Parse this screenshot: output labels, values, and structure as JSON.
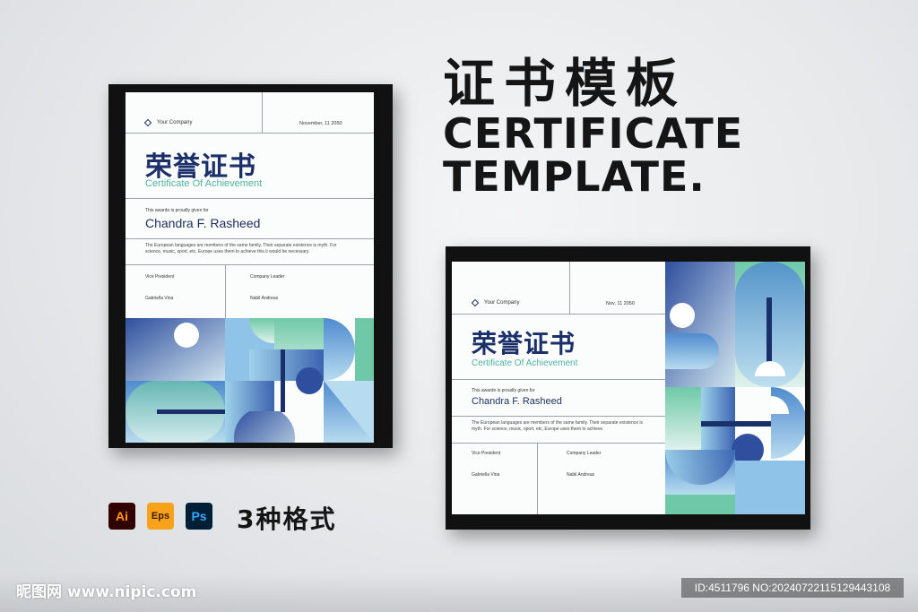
{
  "headline": {
    "cn": "证书模板",
    "en_line1": "CERTIFICATE",
    "en_line2": "TEMPLATE."
  },
  "certificate": {
    "company": "Your Company",
    "title_cn": "荣誉证书",
    "subtitle": "Certificate Of Achievement",
    "given_for": "This awarde is proudly given for",
    "recipient": "Chandra F. Rasheed",
    "description": "The European languages are members of the same family. Their separate existence is myth. For science, music, sport, etc, Europe uses them to achieve this it would be necessary.",
    "signer1_title": "Vice President",
    "signer1_name": "Gabriella Vina",
    "signer2_title": "Company Leader",
    "signer2_name": "Nabil Andreas"
  },
  "portrait_date": "November, 11 2050",
  "landscape_date": "Nov, 11 2050",
  "landscape_description": "The European languages are members of the same family. Their separate existence is myth. For science, music, sport, etc, Europe uses them to achieve.",
  "formats": {
    "badges": [
      {
        "label": "Ai",
        "bg": "#330000",
        "fg": "#ff9a00"
      },
      {
        "label": "Eps",
        "bg": "#f7a21b",
        "fg": "#3a1a00"
      },
      {
        "label": "Ps",
        "bg": "#001e36",
        "fg": "#31a8ff"
      }
    ],
    "label": "3种格式"
  },
  "watermark": {
    "site": "昵图网 www.nipic.com",
    "id_text": "ID:4511796 NO:20240722115129443108"
  },
  "colors": {
    "navy": "#1b2f6b",
    "teal": "#4fb39a",
    "blue": "#3b63b0",
    "sky": "#8fc3e8",
    "mint": "#6fc9a8"
  }
}
